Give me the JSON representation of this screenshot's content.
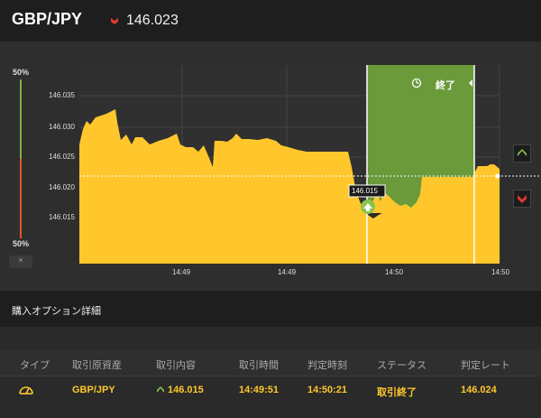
{
  "header": {
    "pair": "GBP/JPY",
    "rate": "146.023"
  },
  "gauge": {
    "top_label": "50%",
    "bottom_label": "50%",
    "close_label": "×"
  },
  "chart": {
    "y_ticks": [
      "146.035",
      "146.030",
      "146.025",
      "146.020",
      "146.015"
    ],
    "x_ticks": [
      "14:49",
      "14:49",
      "14:50",
      "14:50"
    ],
    "end_label": "終了",
    "entry_label": "146.015",
    "colors": {
      "area": "#ffc72c",
      "expired_zone": "#6a9a3a",
      "up": "#8bc34a",
      "down": "#e53935"
    }
  },
  "details": {
    "title": "購入オプション詳細"
  },
  "table": {
    "headers": [
      "タイプ",
      "取引原資産",
      "取引内容",
      "取引時間",
      "判定時刻",
      "ステータス",
      "判定レート"
    ],
    "row": {
      "type_icon": "gauge-icon",
      "asset": "GBP/JPY",
      "trade": "146.015",
      "trade_time": "14:49:51",
      "judge_time": "14:50:21",
      "status": "取引終了",
      "judge_rate": "146.024"
    }
  }
}
